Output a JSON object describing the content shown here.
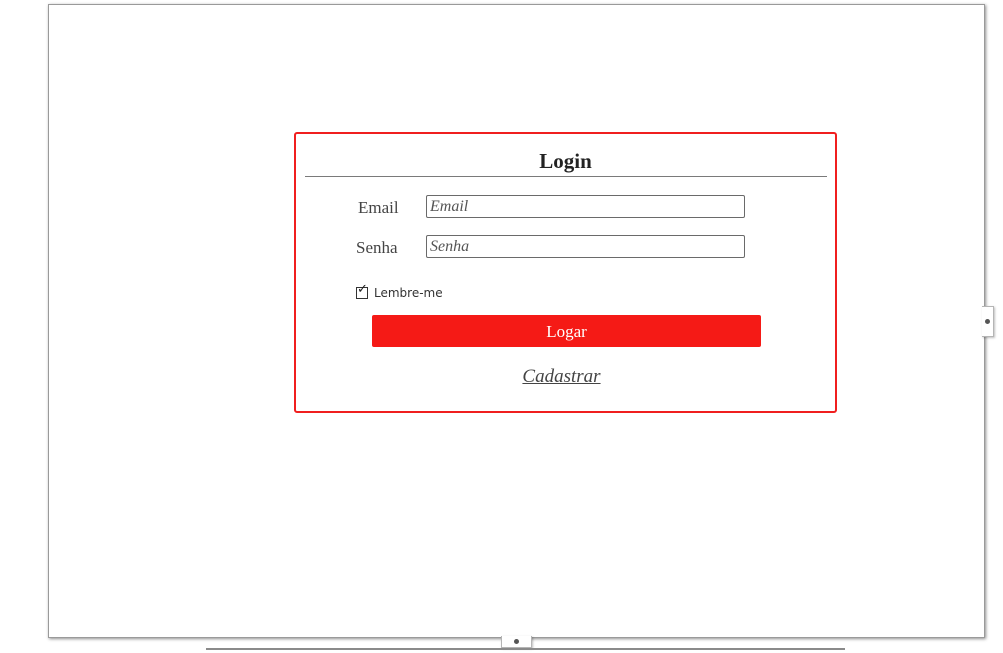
{
  "login": {
    "title": "Login",
    "email": {
      "label": "Email",
      "placeholder": "Email"
    },
    "password": {
      "label": "Senha",
      "placeholder": "Senha"
    },
    "remember": {
      "label": "Lembre-me",
      "checked": true
    },
    "submit_label": "Logar",
    "register_label": "Cadastrar"
  },
  "colors": {
    "accent": "#f51a16",
    "panel_border": "#f01f1f"
  },
  "icons": {
    "checkbox": "check-icon"
  }
}
